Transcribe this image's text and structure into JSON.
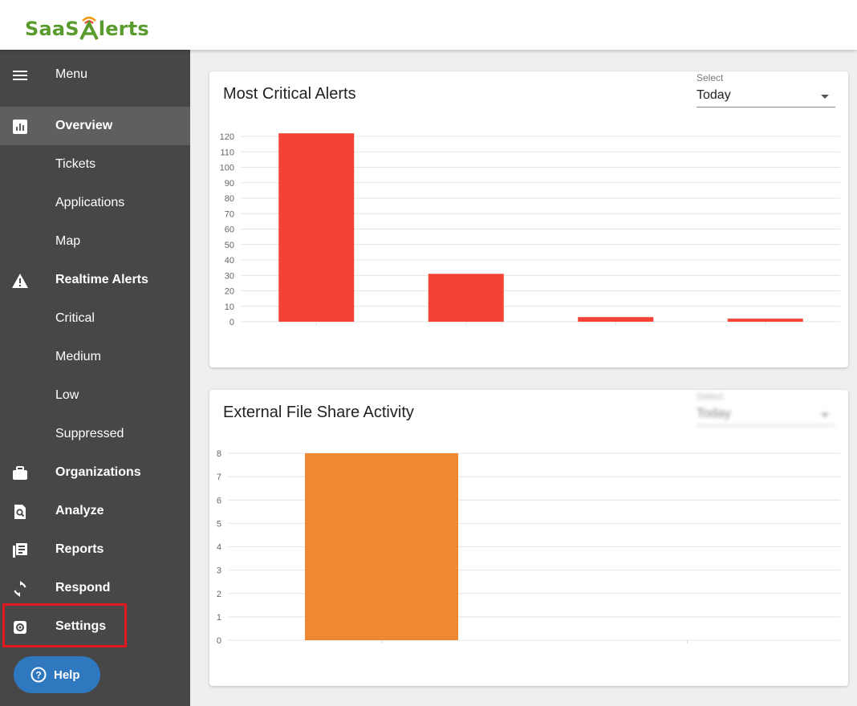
{
  "header": {
    "logo_text_left": "SaaS",
    "logo_text_right": "lerts",
    "logo_wave_icon": "wifi-a-icon",
    "logo_color": "#5a9b2e"
  },
  "sidebar": {
    "menu_label": "Menu",
    "items": [
      {
        "key": "overview",
        "label": "Overview",
        "icon": "bar-chart-icon",
        "bold": true,
        "active": true
      },
      {
        "key": "tickets",
        "label": "Tickets",
        "bold": false
      },
      {
        "key": "applications",
        "label": "Applications",
        "bold": false
      },
      {
        "key": "map",
        "label": "Map",
        "bold": false
      },
      {
        "key": "realtime-alerts",
        "label": "Realtime Alerts",
        "icon": "warning-icon",
        "bold": true
      },
      {
        "key": "critical",
        "label": "Critical",
        "bold": false
      },
      {
        "key": "medium",
        "label": "Medium",
        "bold": false
      },
      {
        "key": "low",
        "label": "Low",
        "bold": false
      },
      {
        "key": "suppressed",
        "label": "Suppressed",
        "bold": false
      },
      {
        "key": "organizations",
        "label": "Organizations",
        "icon": "briefcase-icon",
        "bold": true
      },
      {
        "key": "analyze",
        "label": "Analyze",
        "icon": "search-doc-icon",
        "bold": true
      },
      {
        "key": "reports",
        "label": "Reports",
        "icon": "reports-icon",
        "bold": true
      },
      {
        "key": "respond",
        "label": "Respond",
        "icon": "refresh-icon",
        "bold": true
      },
      {
        "key": "settings",
        "label": "Settings",
        "icon": "gear-icon",
        "bold": true
      }
    ],
    "help_label": "Help",
    "colors": {
      "background": "#474747",
      "active": "#5f5f5f",
      "highlight_border": "#e0191e",
      "help": "#2f78c0"
    }
  },
  "cards": {
    "critical": {
      "title": "Most Critical Alerts",
      "select_label": "Select",
      "select_value": "Today"
    },
    "fileshare": {
      "title": "External File Share Activity",
      "select_label": "Select",
      "select_value": "Today"
    }
  },
  "chart_data": [
    {
      "type": "bar",
      "title": "Most Critical Alerts",
      "categories": [
        "",
        "",
        "",
        ""
      ],
      "values": [
        122,
        31,
        3,
        2
      ],
      "ylim": [
        0,
        120
      ],
      "yticks": [
        "0",
        "10",
        "20",
        "30",
        "40",
        "50",
        "60",
        "70",
        "80",
        "90",
        "100",
        "110",
        "120"
      ],
      "grid": true,
      "color": "#f44336"
    },
    {
      "type": "bar",
      "title": "External File Share Activity",
      "categories": [
        "",
        ""
      ],
      "values": [
        8,
        0
      ],
      "ylim": [
        0,
        8
      ],
      "yticks": [
        "0",
        "1",
        "2",
        "3",
        "4",
        "5",
        "6",
        "7",
        "8"
      ],
      "grid": true,
      "color": "#ef8832"
    }
  ]
}
